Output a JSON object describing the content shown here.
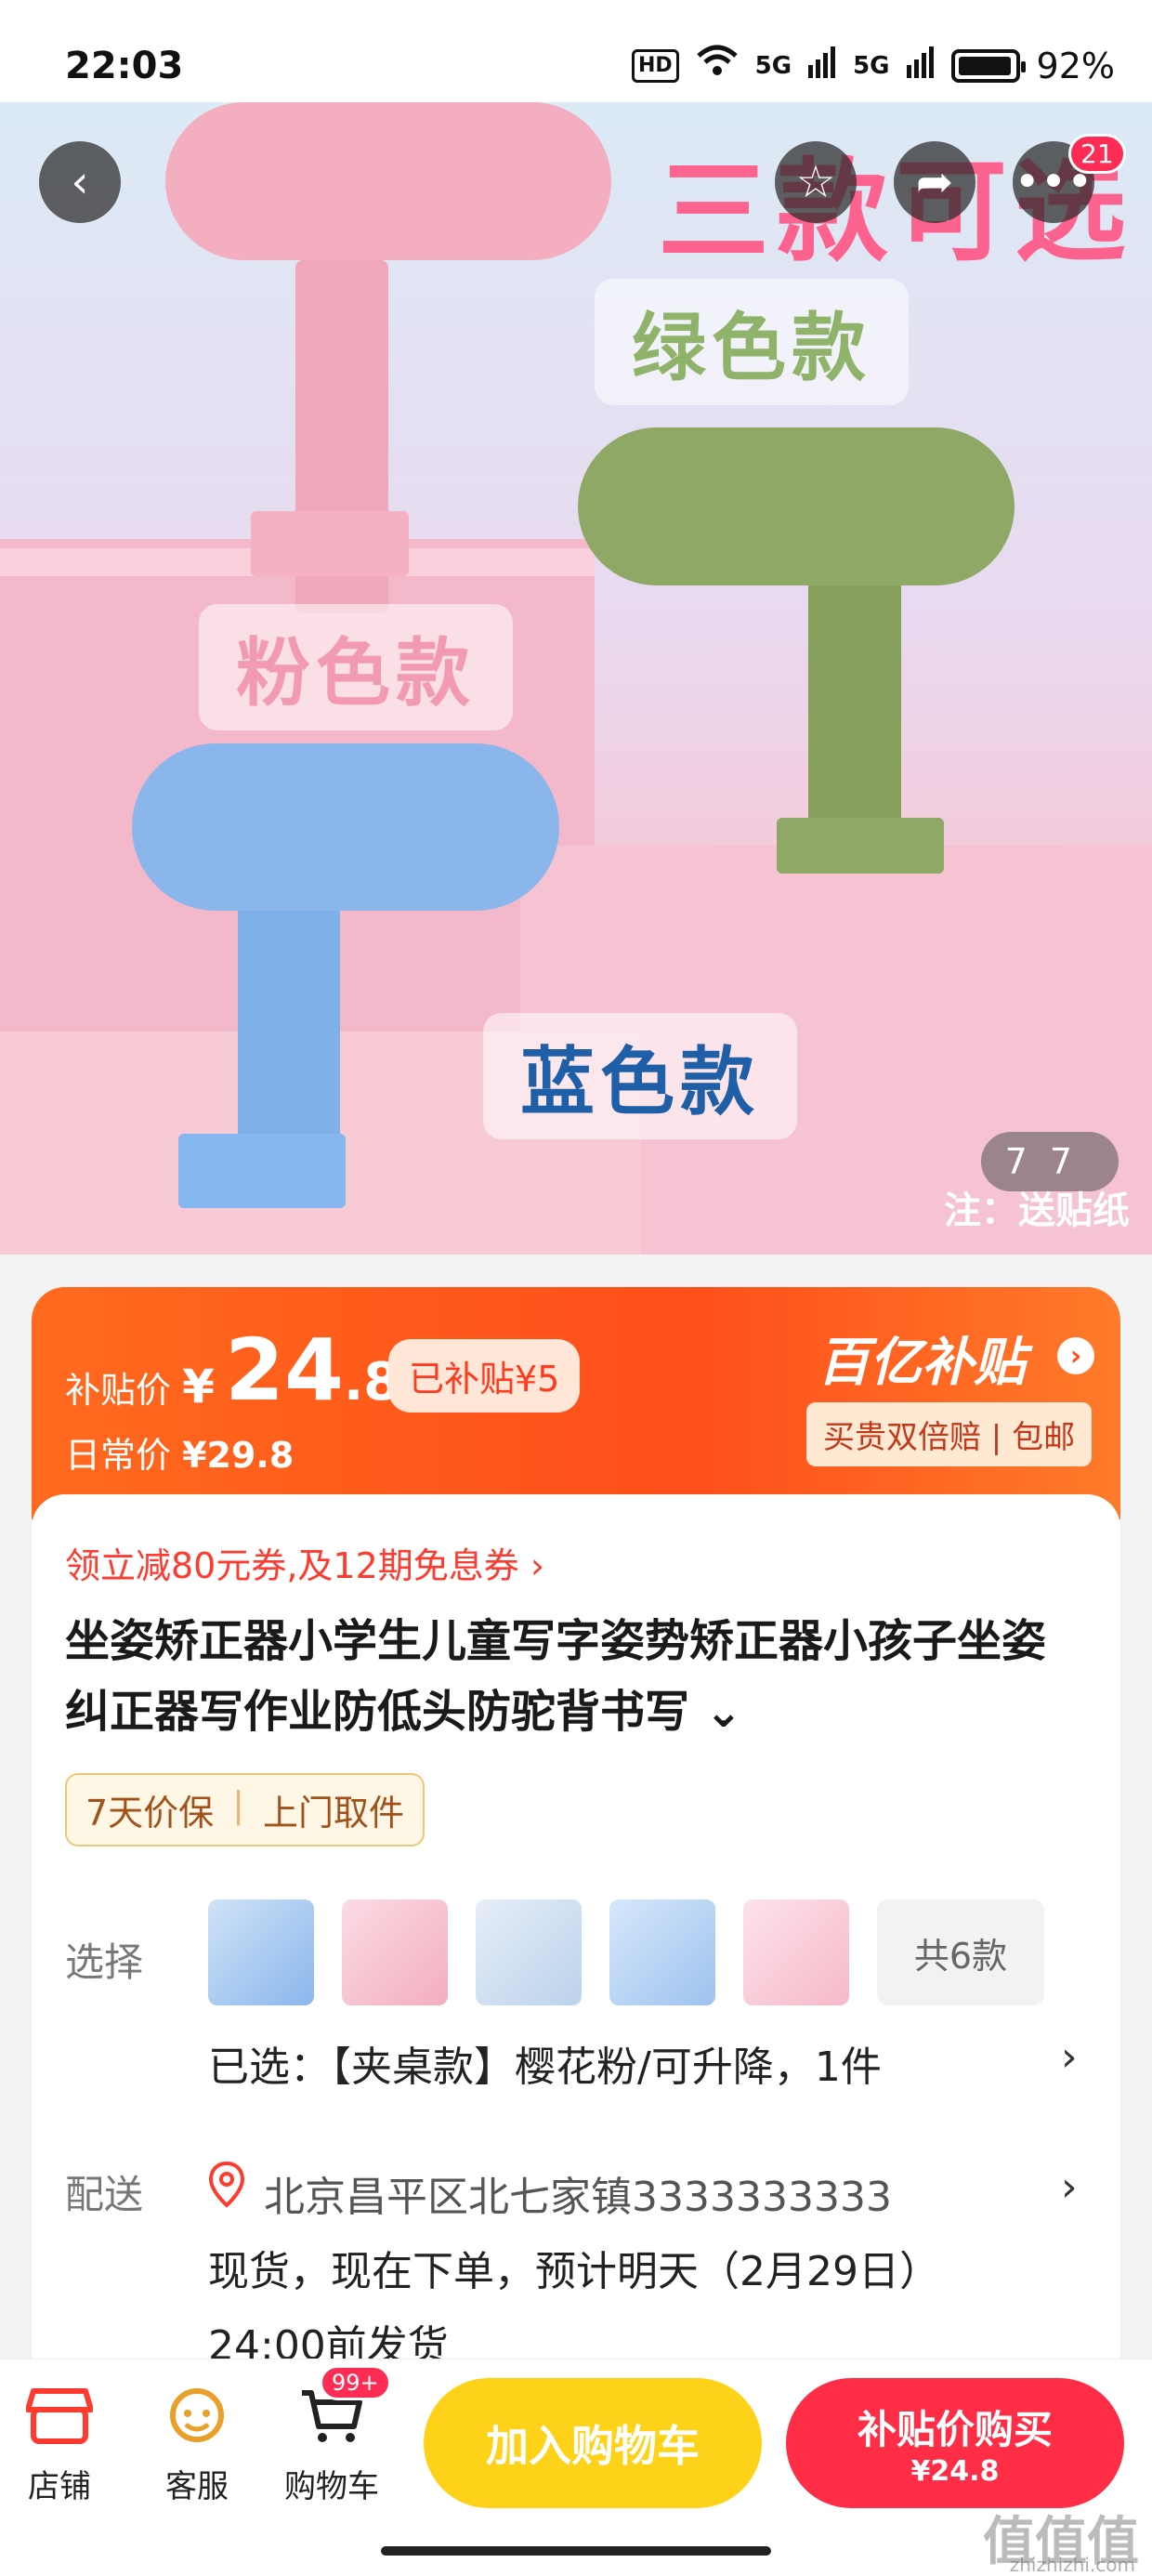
{
  "status_bar": {
    "time": "22:03",
    "hd": "HD",
    "signal1": "5G",
    "signal2": "5G",
    "battery": "92%"
  },
  "hero": {
    "title": "三款可选",
    "label_green": "绿色款",
    "label_pink": "粉色款",
    "label_blue": "蓝色款",
    "counter_current": "7",
    "counter_total": "7",
    "note": "注：送贴纸",
    "colors": {
      "pink": "#f3aec0",
      "green": "#8fa865",
      "blue": "#8bb6ec"
    }
  },
  "top_actions": {
    "badge_count": "21"
  },
  "price": {
    "subsidy_label": "补贴价",
    "currency": "¥",
    "price_int": "24",
    "price_dec": ".8",
    "subsidized_chip": "已补贴¥5",
    "daily_label": "日常价",
    "daily_price": "¥29.8",
    "brand": "百亿补贴",
    "guarantee": "买贵双倍赔 | 包邮"
  },
  "coupon": "领立减80元券,及12期免息券",
  "product_title": "坐姿矫正器小学生儿童写字姿势矫正器小孩子坐姿纠正器写作业防低头防驼背书写",
  "services": [
    "7天价保",
    "上门取件"
  ],
  "select": {
    "label": "选择",
    "more": "共6款",
    "selected": "已选：【夹桌款】樱花粉/可升降，1件"
  },
  "delivery": {
    "label": "配送",
    "address": "北京昌平区北七家镇3333333333",
    "line1": "现货，现在下单，预计明天（2月29日）",
    "line2": "24:00前发货"
  },
  "bottom": {
    "shop": "店铺",
    "service": "客服",
    "cart": "购物车",
    "cart_badge": "99+",
    "add_cart": "加入购物车",
    "buy_label": "补贴价购买",
    "buy_price": "¥24.8"
  },
  "watermark": "值值值",
  "watermark_url": "zhizhizhi.com"
}
